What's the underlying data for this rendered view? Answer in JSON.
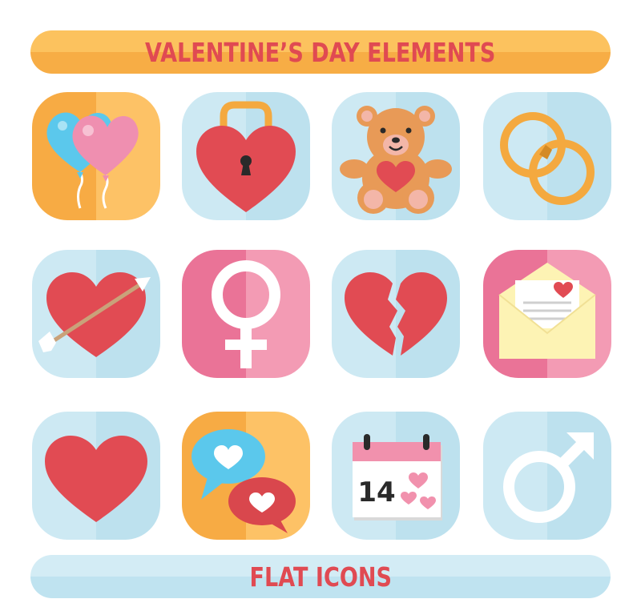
{
  "header": {
    "title": "VALENTINE’S DAY ELEMENTS"
  },
  "footer": {
    "title": "FLAT ICONS"
  },
  "colors": {
    "banner_top_light": "#fcc25e",
    "banner_top_dark": "#f7ad45",
    "banner_bottom_light": "#d3ecf5",
    "banner_bottom_dark": "#bfe3f0",
    "title_text": "#e04a52",
    "tile_blue_light": "#cde9f3",
    "tile_blue_dark": "#bde1ee",
    "tile_orange_light": "#fdc266",
    "tile_orange_dark": "#f7ab44",
    "tile_pink_light": "#f39bb4",
    "tile_pink_dark": "#ea7397",
    "heart_red": "#e14b53"
  },
  "icons": [
    {
      "name": "balloons-icon"
    },
    {
      "name": "heart-padlock-icon"
    },
    {
      "name": "teddy-bear-icon"
    },
    {
      "name": "wedding-rings-icon"
    },
    {
      "name": "heart-arrow-icon"
    },
    {
      "name": "female-symbol-icon"
    },
    {
      "name": "broken-heart-icon"
    },
    {
      "name": "love-letter-icon"
    },
    {
      "name": "heart-icon"
    },
    {
      "name": "love-chat-bubbles-icon"
    },
    {
      "name": "calendar-icon"
    },
    {
      "name": "male-symbol-icon"
    }
  ],
  "calendar": {
    "day": "14"
  }
}
